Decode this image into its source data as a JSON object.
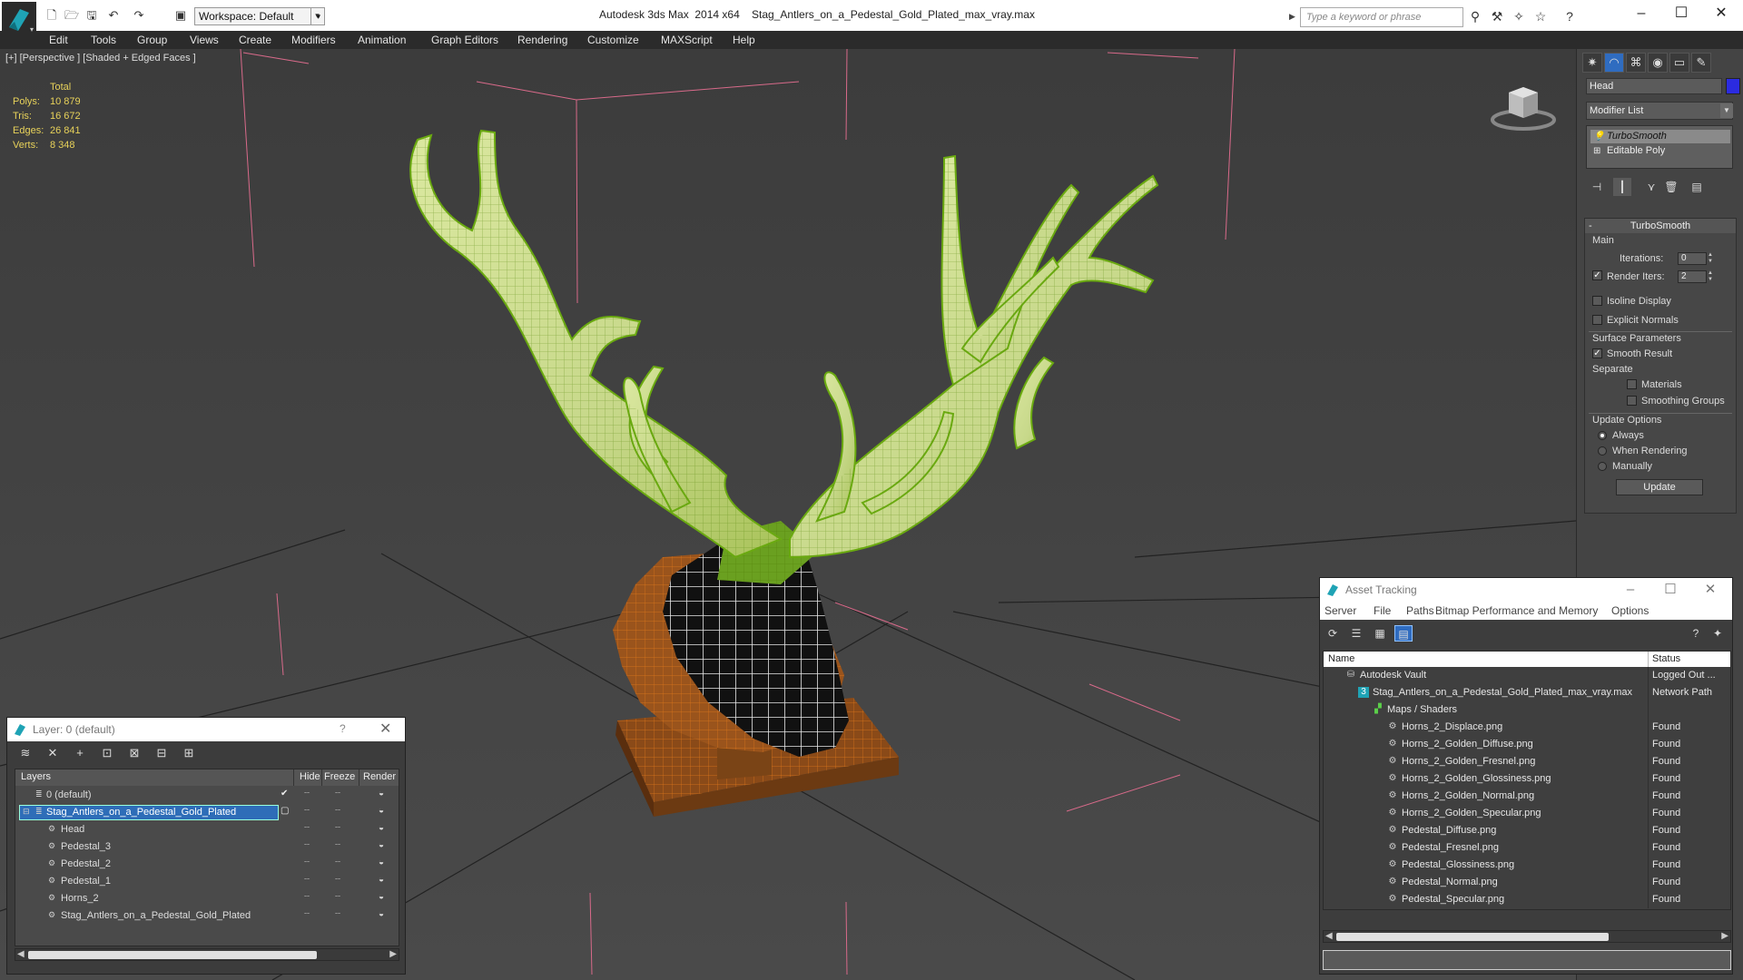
{
  "titlebar": {
    "workspace": "Workspace: Default",
    "app_title": "Autodesk 3ds Max  2014 x64",
    "file_title": "Stag_Antlers_on_a_Pedestal_Gold_Plated_max_vray.max",
    "search_placeholder": "Type a keyword or phrase"
  },
  "menu": [
    "Edit",
    "Tools",
    "Group",
    "Views",
    "Create",
    "Modifiers",
    "Animation",
    "Graph Editors",
    "Rendering",
    "Customize",
    "MAXScript",
    "Help"
  ],
  "viewport": {
    "label": "[+] [Perspective ] [Shaded + Edged Faces ]",
    "stats": {
      "total_label": "Total",
      "rows": [
        {
          "label": "Polys:",
          "value": "10 879"
        },
        {
          "label": "Tris:",
          "value": "16 672"
        },
        {
          "label": "Edges:",
          "value": "26 841"
        },
        {
          "label": "Verts:",
          "value": "8 348"
        }
      ]
    }
  },
  "command_panel": {
    "object_name": "Head",
    "object_color": "#2b2be0",
    "modifier_list": "Modifier List",
    "stack": [
      "TurboSmooth",
      "Editable Poly"
    ],
    "rollout_title": "TurboSmooth",
    "main_label": "Main",
    "iterations_label": "Iterations:",
    "iterations_value": "0",
    "render_iters_label": "Render Iters:",
    "render_iters_value": "2",
    "render_iters_checked": true,
    "isoline_label": "Isoline Display",
    "explicit_normals_label": "Explicit Normals",
    "surface_params_label": "Surface Parameters",
    "smooth_result_label": "Smooth Result",
    "separate_label": "Separate",
    "materials_label": "Materials",
    "smoothing_groups_label": "Smoothing Groups",
    "update_options_label": "Update Options",
    "always_label": "Always",
    "when_rendering_label": "When Rendering",
    "manually_label": "Manually",
    "update_button": "Update"
  },
  "layer_dialog": {
    "title": "Layer: 0 (default)",
    "help": "?",
    "columns": [
      "Layers",
      "Hide",
      "Freeze",
      "Render"
    ],
    "rows": [
      {
        "name": "0 (default)",
        "level": 0
      },
      {
        "name": "Stag_Antlers_on_a_Pedestal_Gold_Plated",
        "level": 0
      },
      {
        "name": "Head",
        "level": 1
      },
      {
        "name": "Pedestal_3",
        "level": 1
      },
      {
        "name": "Pedestal_2",
        "level": 1
      },
      {
        "name": "Pedestal_1",
        "level": 1
      },
      {
        "name": "Horns_2",
        "level": 1
      },
      {
        "name": "Stag_Antlers_on_a_Pedestal_Gold_Plated",
        "level": 1
      }
    ]
  },
  "asset_tracking": {
    "title": "Asset Tracking",
    "menu": [
      "Server",
      "File",
      "Paths",
      "Bitmap Performance and Memory",
      "Options"
    ],
    "columns": [
      "Name",
      "Status"
    ],
    "rows": [
      {
        "name": "Autodesk Vault",
        "status": "Logged Out ...",
        "level": 0
      },
      {
        "name": "Stag_Antlers_on_a_Pedestal_Gold_Plated_max_vray.max",
        "status": "Network Path",
        "level": 1
      },
      {
        "name": "Maps / Shaders",
        "status": "",
        "level": 2
      },
      {
        "name": "Horns_2_Displace.png",
        "status": "Found",
        "level": 3
      },
      {
        "name": "Horns_2_Golden_Diffuse.png",
        "status": "Found",
        "level": 3
      },
      {
        "name": "Horns_2_Golden_Fresnel.png",
        "status": "Found",
        "level": 3
      },
      {
        "name": "Horns_2_Golden_Glossiness.png",
        "status": "Found",
        "level": 3
      },
      {
        "name": "Horns_2_Golden_Normal.png",
        "status": "Found",
        "level": 3
      },
      {
        "name": "Horns_2_Golden_Specular.png",
        "status": "Found",
        "level": 3
      },
      {
        "name": "Pedestal_Diffuse.png",
        "status": "Found",
        "level": 3
      },
      {
        "name": "Pedestal_Fresnel.png",
        "status": "Found",
        "level": 3
      },
      {
        "name": "Pedestal_Glossiness.png",
        "status": "Found",
        "level": 3
      },
      {
        "name": "Pedestal_Normal.png",
        "status": "Found",
        "level": 3
      },
      {
        "name": "Pedestal_Specular.png",
        "status": "Found",
        "level": 3
      }
    ]
  }
}
